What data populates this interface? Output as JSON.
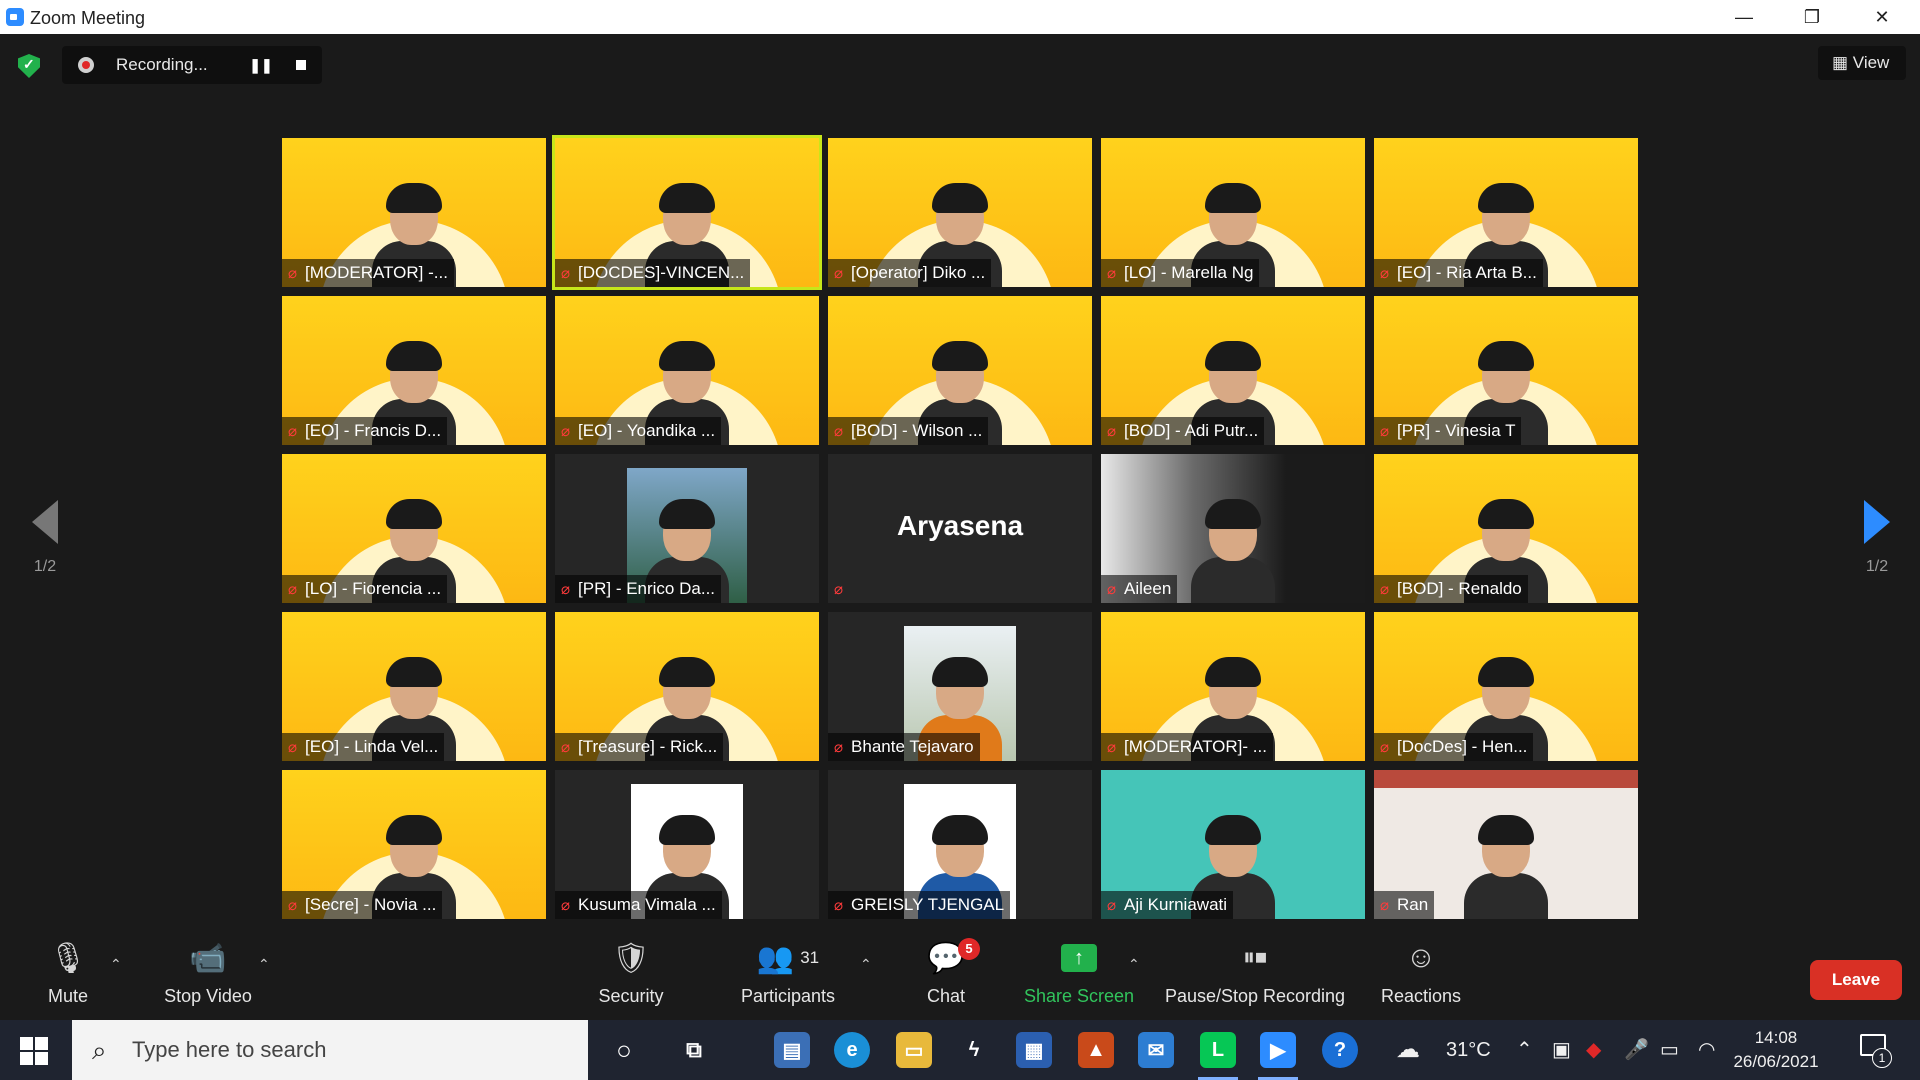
{
  "window": {
    "title": "Zoom Meeting",
    "minimize": "—",
    "restore": "❐",
    "close": "✕"
  },
  "recording": {
    "status": "Recording...",
    "pause": "❚❚"
  },
  "view": {
    "label": "View"
  },
  "pager": {
    "left": "1/2",
    "right": "1/2"
  },
  "participants_grid": [
    {
      "name": "[MODERATOR] -...",
      "video": "yellow",
      "active": false
    },
    {
      "name": "[DOCDES]-VINCEN...",
      "video": "yellow",
      "active": true
    },
    {
      "name": "[Operator] Diko ...",
      "video": "yellow",
      "active": false
    },
    {
      "name": "[LO] - Marella Ng",
      "video": "yellow",
      "active": false
    },
    {
      "name": "[EO] - Ria Arta B...",
      "video": "yellow",
      "active": false
    },
    {
      "name": "[EO] - Francis D...",
      "video": "yellow",
      "active": false
    },
    {
      "name": "[EO] - Yoandika ...",
      "video": "yellow",
      "active": false
    },
    {
      "name": "[BOD] - Wilson ...",
      "video": "yellow",
      "active": false
    },
    {
      "name": "[BOD] - Adi Putr...",
      "video": "yellow",
      "active": false
    },
    {
      "name": "[PR] - Vinesia T",
      "video": "yellow",
      "active": false
    },
    {
      "name": "[LO] - Fiorencia ...",
      "video": "yellow",
      "active": false
    },
    {
      "name": "[PR] - Enrico Da...",
      "video": "photo",
      "active": false
    },
    {
      "name": "",
      "video": "none",
      "display_name": "Aryasena",
      "active": false
    },
    {
      "name": "Aileen",
      "video": "dark",
      "active": false
    },
    {
      "name": "[BOD] - Renaldo",
      "video": "yellow",
      "active": false
    },
    {
      "name": "[EO] - Linda Vel...",
      "video": "yellow",
      "active": false
    },
    {
      "name": "[Treasure] - Rick...",
      "video": "yellow",
      "active": false
    },
    {
      "name": "Bhante Tejavaro",
      "video": "photo",
      "active": false
    },
    {
      "name": "[MODERATOR]- ...",
      "video": "yellow",
      "active": false
    },
    {
      "name": "[DocDes] - Hen...",
      "video": "yellow",
      "active": false
    },
    {
      "name": "[Secre] - Novia ...",
      "video": "yellow",
      "active": false
    },
    {
      "name": "Kusuma Vimala ...",
      "video": "photo",
      "active": false
    },
    {
      "name": "GREISLY TJENGAL",
      "video": "photo",
      "active": false
    },
    {
      "name": "Aji Kurniawati",
      "video": "teal",
      "active": false
    },
    {
      "name": "Ran",
      "video": "room",
      "active": false
    }
  ],
  "toolbar": {
    "mute": "Mute",
    "stop_video": "Stop Video",
    "security": "Security",
    "participants": "Participants",
    "participants_count": "31",
    "chat": "Chat",
    "chat_badge": "5",
    "share_screen": "Share Screen",
    "pause_stop_recording": "Pause/Stop Recording",
    "reactions": "Reactions",
    "leave": "Leave"
  },
  "taskbar": {
    "search_placeholder": "Type here to search",
    "weather": "31°C",
    "time": "14:08",
    "date": "26/06/2021",
    "notifications": "1"
  },
  "colors": {
    "accent": "#2d8cff",
    "leave": "#d93025",
    "share": "#22b14c",
    "active_speaker": "#c7e61a",
    "tile_bg": "#fdb813"
  }
}
